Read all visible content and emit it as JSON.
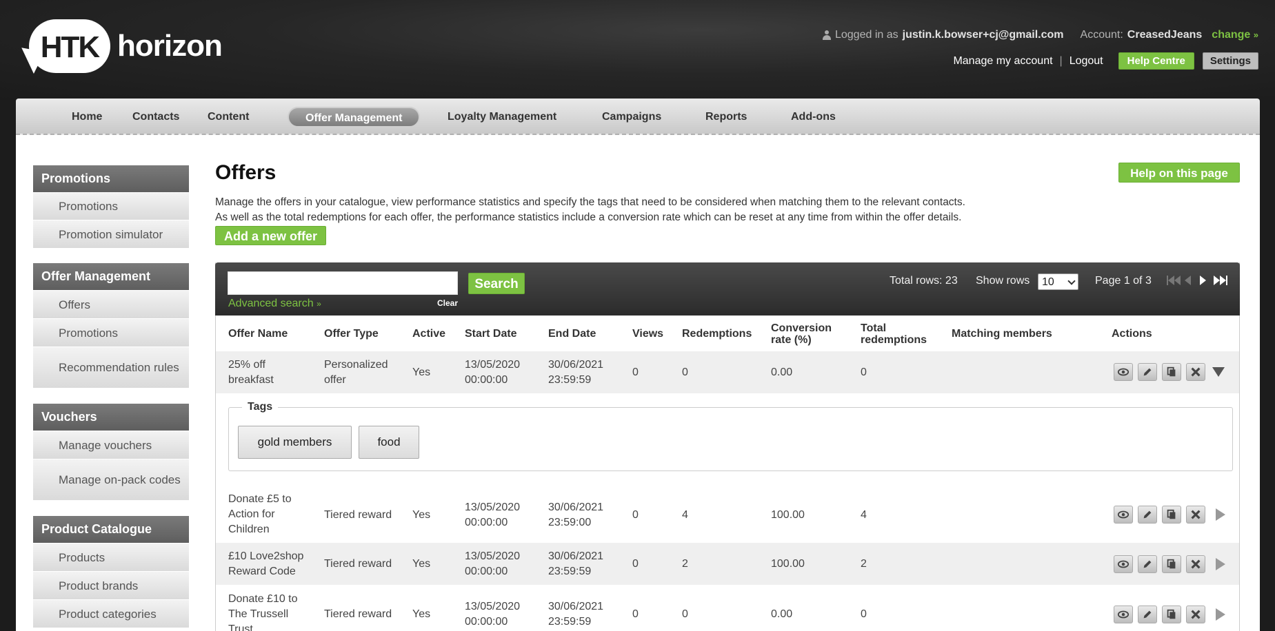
{
  "header": {
    "logo_mark": "HTK",
    "logo_text": "horizon",
    "logged_in_label": "Logged in as",
    "user_email": "justin.k.bowser+cj@gmail.com",
    "account_label": "Account:",
    "account_name": "CreasedJeans",
    "change_label": "change",
    "manage_account": "Manage my account",
    "logout": "Logout",
    "help_centre": "Help Centre",
    "settings": "Settings"
  },
  "nav": [
    "Home",
    "Contacts",
    "Content",
    "Offer Management",
    "Loyalty Management",
    "Campaigns",
    "Reports",
    "Add-ons"
  ],
  "nav_active": "Offer Management",
  "sidebar": [
    {
      "title": "Promotions",
      "items": [
        "Promotions",
        "Promotion simulator"
      ]
    },
    {
      "title": "Offer Management",
      "items": [
        "Offers",
        "Promotions",
        "Recommendation rules"
      ]
    },
    {
      "title": "Vouchers",
      "items": [
        "Manage vouchers",
        "Manage on-pack codes"
      ]
    },
    {
      "title": "Product Catalogue",
      "items": [
        "Products",
        "Product brands",
        "Product categories"
      ]
    }
  ],
  "page": {
    "title": "Offers",
    "help_button": "Help on this page",
    "desc_line1": "Manage the offers in your catalogue, view performance statistics and specify the tags that need to be considered when matching them to the relevant contacts.",
    "desc_line2": "As well as the total redemptions for each offer, the performance statistics include a conversion rate which can be reset at any time from within the offer details.",
    "add_button": "Add a new offer"
  },
  "toolbar": {
    "search_value": "",
    "search_button": "Search",
    "advanced_search": "Advanced search",
    "clear": "Clear",
    "total_rows": "Total rows: 23",
    "show_rows_label": "Show rows",
    "show_rows_value": "10",
    "page_info": "Page 1 of 3"
  },
  "table": {
    "headers": {
      "name": "Offer Name",
      "type": "Offer Type",
      "active": "Active",
      "start": "Start Date",
      "end": "End Date",
      "views": "Views",
      "redemptions": "Redemptions",
      "conv1": "Conversion",
      "conv2": "rate (%)",
      "total1": "Total",
      "total2": "redemptions",
      "matching": "Matching members",
      "actions": "Actions"
    },
    "rows": [
      {
        "name1": "25% off",
        "name2": "breakfast",
        "name3": "",
        "type1": "Personalized",
        "type2": "offer",
        "active": "Yes",
        "start1": "13/05/2020",
        "start2": "00:00:00",
        "end1": "30/06/2021",
        "end2": "23:59:59",
        "views": "0",
        "redemptions": "0",
        "conv": "0.00",
        "total": "0",
        "matching": ""
      },
      {
        "name1": "Donate £5 to",
        "name2": "Action for",
        "name3": "Children",
        "type1": "Tiered reward",
        "type2": "",
        "active": "Yes",
        "start1": "13/05/2020",
        "start2": "00:00:00",
        "end1": "30/06/2021",
        "end2": "23:59:00",
        "views": "0",
        "redemptions": "4",
        "conv": "100.00",
        "total": "4",
        "matching": ""
      },
      {
        "name1": "£10 Love2shop",
        "name2": "Reward Code",
        "name3": "",
        "type1": "Tiered reward",
        "type2": "",
        "active": "Yes",
        "start1": "13/05/2020",
        "start2": "00:00:00",
        "end1": "30/06/2021",
        "end2": "23:59:59",
        "views": "0",
        "redemptions": "2",
        "conv": "100.00",
        "total": "2",
        "matching": ""
      },
      {
        "name1": "Donate £10 to",
        "name2": "The Trussell",
        "name3": "Trust",
        "type1": "Tiered reward",
        "type2": "",
        "active": "Yes",
        "start1": "13/05/2020",
        "start2": "00:00:00",
        "end1": "30/06/2021",
        "end2": "23:59:59",
        "views": "0",
        "redemptions": "0",
        "conv": "0.00",
        "total": "0",
        "matching": ""
      }
    ],
    "tags_legend": "Tags",
    "tags": [
      "gold members",
      "food"
    ]
  },
  "colors": {
    "accent_green": "#7dc242",
    "header_bg": "#1c1c1c"
  }
}
